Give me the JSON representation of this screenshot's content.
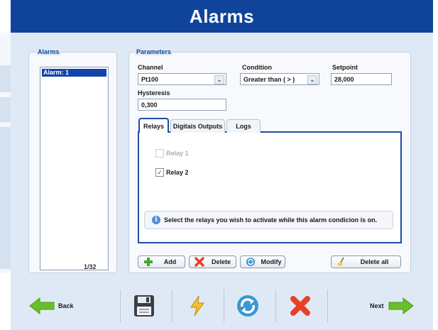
{
  "header": {
    "title": "Alarms"
  },
  "alarms_panel": {
    "legend": "Alarms",
    "items": [
      "Alarm: 1"
    ],
    "count": "1/32"
  },
  "parameters": {
    "legend": "Parameters",
    "channel": {
      "label": "Channel",
      "value": "Pt100"
    },
    "condition": {
      "label": "Condition",
      "value": "Greater than ( > )"
    },
    "setpoint": {
      "label": "Setpoint",
      "value": "28,000"
    },
    "hysteresis": {
      "label": "Hysteresis",
      "value": "0,300"
    }
  },
  "tabs": [
    {
      "label": "Relays",
      "active": true
    },
    {
      "label": "Digitais Outputs",
      "active": false
    },
    {
      "label": "Logs",
      "active": false
    }
  ],
  "relays": [
    {
      "label": "Relay 1",
      "checked": false,
      "enabled": false
    },
    {
      "label": "Relay 2",
      "checked": true,
      "enabled": true
    }
  ],
  "info_text": "Select the relays you wish to activate while this alarm condicion is on.",
  "actions": {
    "add": "Add",
    "delete": "Delete",
    "modify": "Modify",
    "delete_all": "Delete all"
  },
  "navigation": {
    "back": "Back",
    "next": "Next"
  },
  "colors": {
    "header": "#10449a",
    "panel": "#dfe9f5",
    "selection": "#1144a8",
    "nav_arrow": "#6cbd2a",
    "cancel": "#e84028",
    "refresh": "#3a97d5"
  }
}
